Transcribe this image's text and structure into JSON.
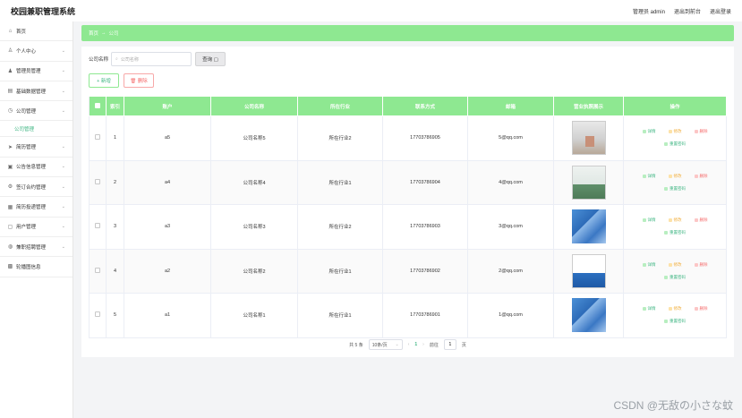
{
  "app": {
    "title": "校园兼职管理系统"
  },
  "header": {
    "user": "管理员 admin",
    "to_front": "退出到前台",
    "logout": "退出登录"
  },
  "sidebar": {
    "items": [
      {
        "label": "首页",
        "icon": "home-icon",
        "glyph": "⌂",
        "expandable": false
      },
      {
        "label": "个人中心",
        "icon": "user-icon",
        "glyph": "♙",
        "expandable": true
      },
      {
        "label": "管理员管理",
        "icon": "admin-icon",
        "glyph": "♟",
        "expandable": true
      },
      {
        "label": "基础数据管理",
        "icon": "database-icon",
        "glyph": "▤",
        "expandable": true
      },
      {
        "label": "公司管理",
        "icon": "clock-icon",
        "glyph": "◷",
        "expandable": true
      },
      {
        "label": "简历管理",
        "icon": "send-icon",
        "glyph": "➤",
        "expandable": true
      },
      {
        "label": "公告信息管理",
        "icon": "notice-icon",
        "glyph": "▣",
        "expandable": true
      },
      {
        "label": "签订合约管理",
        "icon": "contract-icon",
        "glyph": "⚙",
        "expandable": true
      },
      {
        "label": "简历投递管理",
        "icon": "grid-icon",
        "glyph": "▦",
        "expandable": true
      },
      {
        "label": "用户管理",
        "icon": "users-icon",
        "glyph": "▢",
        "expandable": true
      },
      {
        "label": "兼职招聘管理",
        "icon": "job-icon",
        "glyph": "◍",
        "expandable": true
      },
      {
        "label": "轮播图信息",
        "icon": "carousel-icon",
        "glyph": "▩",
        "expandable": false
      }
    ],
    "sub_item": "公司管理"
  },
  "breadcrumb": {
    "home": "首页",
    "arrow": "→",
    "current": "公司"
  },
  "search": {
    "label": "公司名称",
    "placeholder": "公司名称",
    "button": "查询 ▢"
  },
  "actions": {
    "add": "+ 新增",
    "delete": "🗑 删除"
  },
  "table": {
    "headers": [
      "索引",
      "账户",
      "公司名称",
      "所在行业",
      "联系方式",
      "邮箱",
      "营业执照展示",
      "操作"
    ],
    "rows": [
      {
        "index": "1",
        "account": "a5",
        "company": "公司名称5",
        "industry": "所在行业2",
        "phone": "17703786905",
        "email": "5@qq.com",
        "image": "lobby"
      },
      {
        "index": "2",
        "account": "a4",
        "company": "公司名称4",
        "industry": "所在行业1",
        "phone": "17703786904",
        "email": "4@qq.com",
        "image": "wall"
      },
      {
        "index": "3",
        "account": "a3",
        "company": "公司名称3",
        "industry": "所在行业2",
        "phone": "17703786903",
        "email": "3@qq.com",
        "image": "tower"
      },
      {
        "index": "4",
        "account": "a2",
        "company": "公司名称2",
        "industry": "所在行业1",
        "phone": "17703786902",
        "email": "2@qq.com",
        "image": "card"
      },
      {
        "index": "5",
        "account": "a1",
        "company": "公司名称1",
        "industry": "所在行业1",
        "phone": "17703786901",
        "email": "1@qq.com",
        "image": "tower"
      }
    ],
    "ops": {
      "detail": "详情",
      "edit": "修改",
      "delete": "删除",
      "reset": "重置密码"
    }
  },
  "pagination": {
    "total": "共 5 条",
    "page_size": "10条/页",
    "current": "1",
    "goto_label": "前往",
    "goto_value": "1",
    "page_unit": "页"
  },
  "watermark": "CSDN @无敌の小さな蚊"
}
